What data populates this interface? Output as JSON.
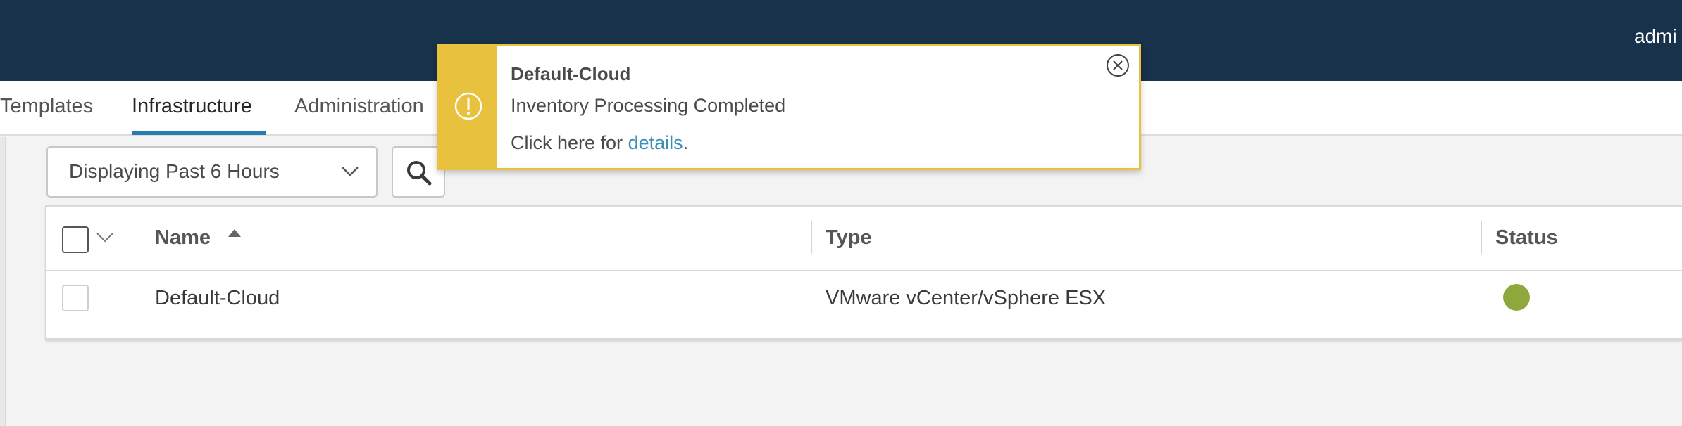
{
  "header": {
    "user_label": "admi"
  },
  "tabs": [
    {
      "label": "Templates",
      "active": false
    },
    {
      "label": "Infrastructure",
      "active": true
    },
    {
      "label": "Administration",
      "active": false
    }
  ],
  "filter": {
    "time_range": "Displaying Past 6 Hours"
  },
  "table": {
    "columns": [
      "Name",
      "Type",
      "Status"
    ],
    "sort": {
      "column": "Name",
      "direction": "ascending"
    },
    "rows": [
      {
        "name": "Default-Cloud",
        "type": "VMware vCenter/vSphere ESX",
        "status": "green"
      }
    ]
  },
  "notification": {
    "title": "Default-Cloud",
    "message": "Inventory Processing Completed",
    "details_prefix": "Click here for ",
    "details_link": "details",
    "details_suffix": ".",
    "severity": "warning"
  },
  "colors": {
    "header_bg": "#17324a",
    "tab_accent": "#2a7bb0",
    "warning": "#e8c13f",
    "link": "#3d8fb8",
    "status_ok": "#8fa83c"
  },
  "icons": {
    "notification": "exclamation-circle-icon",
    "close": "close-circle-icon",
    "search": "search-icon",
    "dropdown": "chevron-down-icon",
    "sort": "sort-ascending-icon"
  }
}
